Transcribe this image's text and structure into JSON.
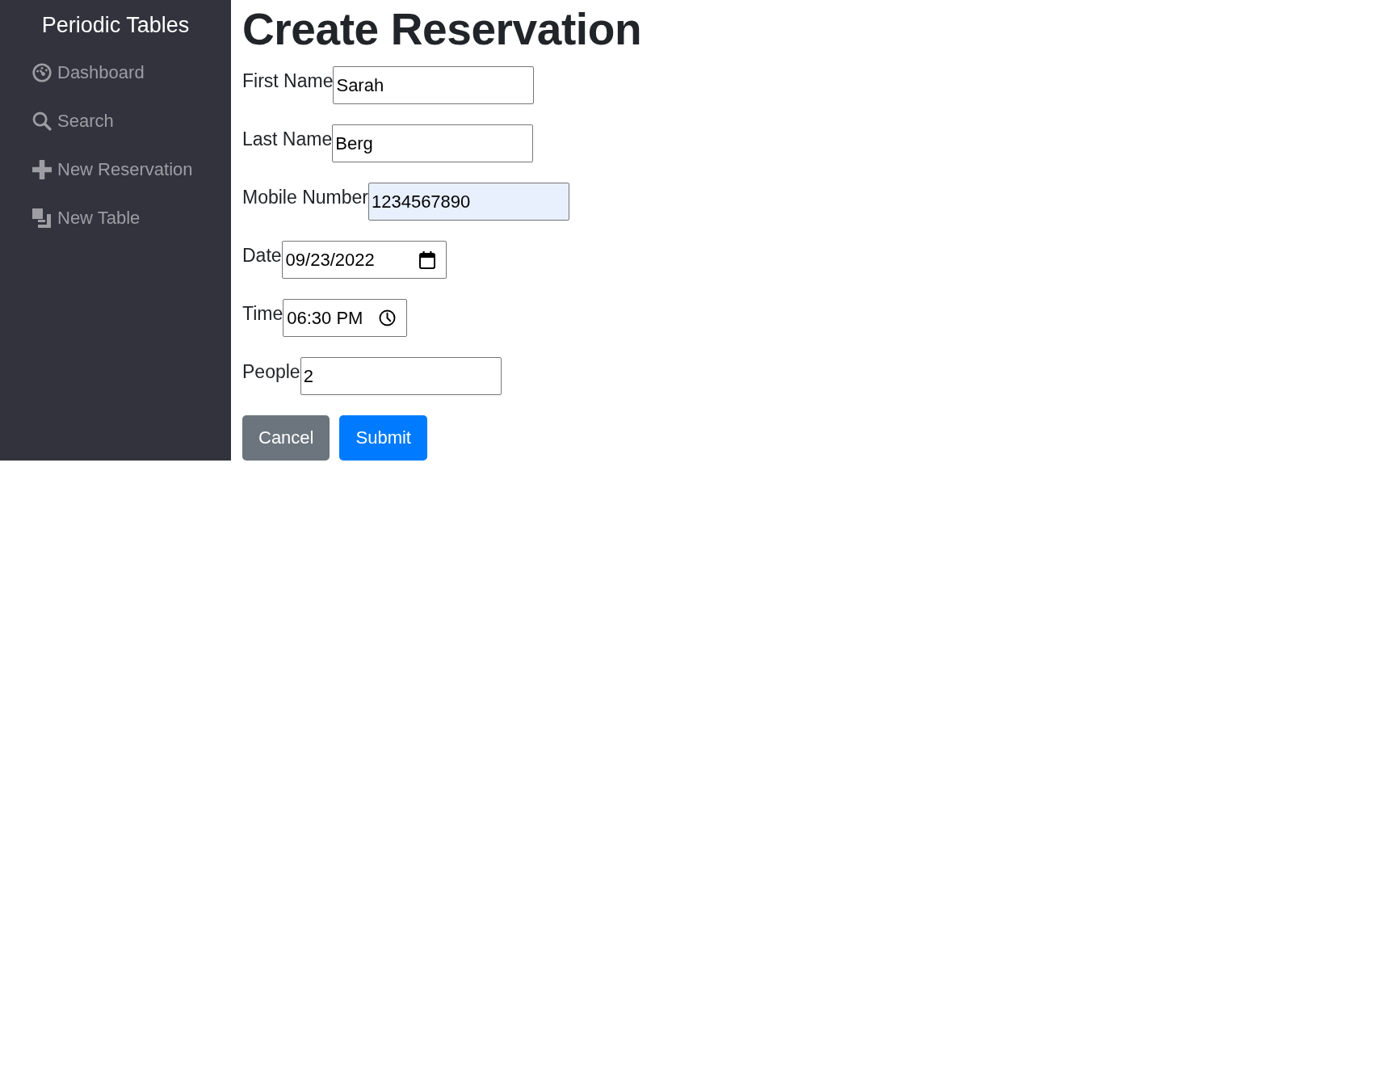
{
  "sidebar": {
    "title": "Periodic Tables",
    "items": [
      {
        "label": "Dashboard",
        "kind": "dashboard"
      },
      {
        "label": "Search",
        "kind": "search"
      },
      {
        "label": "New Reservation",
        "kind": "add"
      },
      {
        "label": "New Table",
        "kind": "table"
      }
    ]
  },
  "form": {
    "title": "Create Reservation",
    "fields": [
      {
        "label": "First Name",
        "value": "Sarah",
        "kind": "text",
        "autofilled": false
      },
      {
        "label": "Last Name",
        "value": "Berg",
        "kind": "text",
        "autofilled": false
      },
      {
        "label": "Mobile Number",
        "value": "1234567890",
        "kind": "tel",
        "autofilled": true
      },
      {
        "label": "Date",
        "value": "09/23/2022",
        "kind": "date",
        "autofilled": false
      },
      {
        "label": "Time",
        "value": "06:30 PM",
        "kind": "time",
        "autofilled": false
      },
      {
        "label": "People",
        "value": "2",
        "kind": "number",
        "autofilled": false
      }
    ],
    "buttons": [
      {
        "label": "Cancel",
        "kind": "secondary"
      },
      {
        "label": "Submit",
        "kind": "primary"
      }
    ]
  }
}
